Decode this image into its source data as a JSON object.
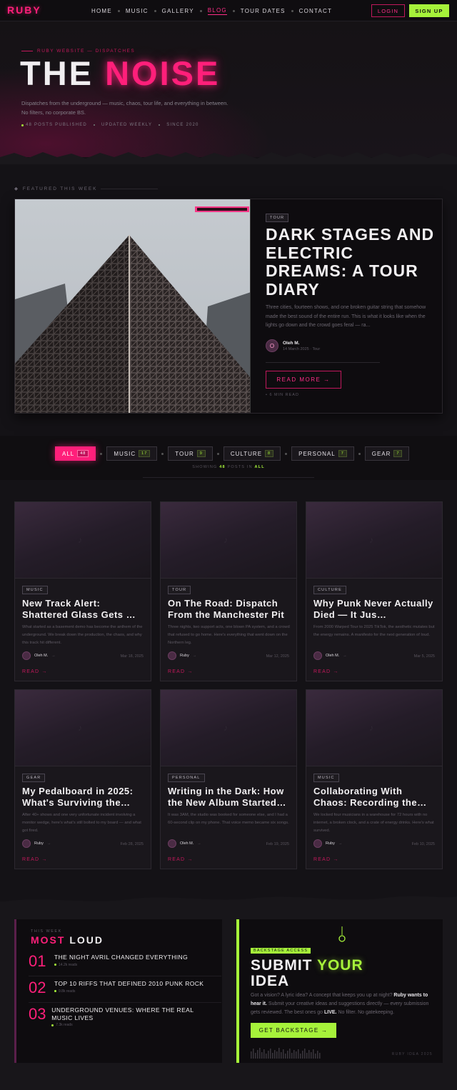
{
  "nav": {
    "logo": "RUBY",
    "links": [
      "HOME",
      "MUSIC",
      "GALLERY",
      "BLOG",
      "TOUR DATES",
      "CONTACT"
    ],
    "active": "BLOG",
    "login": "LOGIN",
    "signup": "SIGN UP"
  },
  "hero": {
    "kicker": "RUBY WEBSITE — DISPATCHES",
    "title_a": "THE ",
    "title_b": "NOISE",
    "subtitle": "Dispatches from the underground — music, chaos, tour life, and everything in between. No filters, no corporate BS.",
    "meta": [
      "48 POSTS PUBLISHED",
      "UPDATED WEEKLY",
      "SINCE 2020"
    ]
  },
  "featured": {
    "label": "FEATURED THIS WEEK",
    "tag": "TOUR",
    "title": "DARK STAGES AND ELECTRIC DREAMS: A TOUR DIARY",
    "excerpt": "Three cities, fourteen shows, and one broken guitar string that somehow made the best sound of the entire run. This is what it looks like when the lights go down and the crowd goes feral — ra...",
    "author": "Oleh M.",
    "avatar": "O",
    "date": "14 March 2025 · Tour",
    "read": "READ MORE →",
    "read_time": "• 6 MIN READ"
  },
  "filters": {
    "items": [
      {
        "label": "ALL",
        "count": "48"
      },
      {
        "label": "MUSIC",
        "count": "17"
      },
      {
        "label": "TOUR",
        "count": "9"
      },
      {
        "label": "CULTURE",
        "count": "8"
      },
      {
        "label": "PERSONAL",
        "count": "7"
      },
      {
        "label": "GEAR",
        "count": "7"
      }
    ],
    "showing_a": "SHOWING ",
    "showing_n": "48",
    "showing_b": " POSTS IN ",
    "showing_c": "ALL"
  },
  "posts": [
    {
      "tag": "MUSIC",
      "title": "New Track Alert: Shattered Glass Gets …",
      "excerpt": "What started as a basement demo has become the anthem of the underground. We break down the production, the chaos, and why this track hit different.",
      "author": "Oleh M.",
      "date": "Mar 18, 2025",
      "read": "READ →"
    },
    {
      "tag": "TOUR",
      "title": "On The Road: Dispatch From the Manchester Pit",
      "excerpt": "Three nights, two support acts, one blown PA system, and a crowd that refused to go home. Here's everything that went down on the Northern leg.",
      "author": "Ruby",
      "date": "Mar 12, 2025",
      "read": "READ →"
    },
    {
      "tag": "CULTURE",
      "title": "Why Punk Never Actually Died — It Jus…",
      "excerpt": "From 2000 Warped Tour to 2025 TikTok, the aesthetic mutates but the energy remains. A manifesto for the next generation of loud.",
      "author": "Oleh M.",
      "date": "Mar 5, 2025",
      "read": "READ →"
    },
    {
      "tag": "GEAR",
      "title": "My Pedalboard in 2025: What's Surviving the…",
      "excerpt": "After 40+ shows and one very unfortunate incident involving a monitor wedge, here's what's still bolted to my board — and what got fired.",
      "author": "Ruby",
      "date": "Feb 28, 2025",
      "read": "READ →"
    },
    {
      "tag": "PERSONAL",
      "title": "Writing in the Dark: How the New Album Started…",
      "excerpt": "It was 3AM, the studio was booked for someone else, and I had a 60-second clip on my phone. That voice memo became six songs.",
      "author": "Oleh M.",
      "date": "Feb 19, 2025",
      "read": "READ →"
    },
    {
      "tag": "MUSIC",
      "title": "Collaborating With Chaos: Recording the…",
      "excerpt": "We locked four musicians in a warehouse for 72 hours with no internet, a broken clock, and a crate of energy drinks. Here's what survived.",
      "author": "Ruby",
      "date": "Feb 10, 2025",
      "read": "READ →"
    }
  ],
  "loud": {
    "kicker": "THIS WEEK",
    "title_a": "MOST",
    "title_b": " LOUD",
    "items": [
      {
        "num": "01",
        "title": "THE NIGHT AVRIL CHANGED EVERYTHING",
        "reads": "14.2k reads"
      },
      {
        "num": "02",
        "title": "TOP 10 RIFFS THAT DEFINED 2010 PUNK ROCK",
        "reads": "9.8k reads"
      },
      {
        "num": "03",
        "title": "UNDERGROUND VENUES: WHERE THE REAL MUSIC LIVES",
        "reads": "7.3k reads"
      }
    ]
  },
  "submit": {
    "badge": "BACKSTAGE ACCESS",
    "title_a": "SUBMIT ",
    "title_b": "YOUR",
    "title_c": "IDEA",
    "text_a": "Got a vision? A lyric idea? A concept that keeps you up at night? ",
    "text_b": "Ruby wants to hear it.",
    "text_c": " Submit your creative ideas and suggestions directly — every submission gets reviewed. The best ones go ",
    "text_d": "LIVE.",
    "text_e": " No filter. No gatekeeping.",
    "button": "GET BACKSTAGE →",
    "foot": "RUBY IDEA 2025"
  },
  "colors": {
    "accent": "#ff1f7a",
    "lime": "#a6f23a",
    "bg": "#141216"
  },
  "icons": {
    "post_placeholder": "music-note-icon"
  }
}
